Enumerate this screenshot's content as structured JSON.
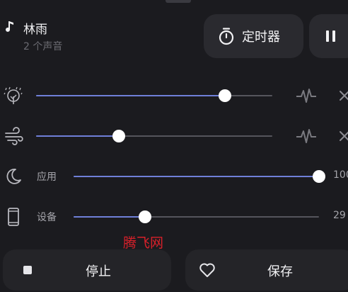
{
  "header": {
    "title": "林雨",
    "subtitle": "2 个声音",
    "timer_label": "定时器"
  },
  "sounds": [
    {
      "label": "",
      "icon": "tree-rain-icon",
      "volume": 0.8,
      "value_text": ""
    },
    {
      "label": "",
      "icon": "wind-icon",
      "volume": 0.35,
      "value_text": ""
    }
  ],
  "channels": [
    {
      "label": "应用",
      "icon": "moon-icon",
      "volume": 1.0,
      "value_text": "100"
    },
    {
      "label": "设备",
      "icon": "phone-icon",
      "volume": 0.29,
      "value_text": "29"
    }
  ],
  "watermark": "腾飞网",
  "footer": {
    "stop_label": "停止",
    "save_label": "保存"
  },
  "colors": {
    "background": "#1b1b1f",
    "accent": "#6f7fd8",
    "button": "#2a2a2f"
  }
}
